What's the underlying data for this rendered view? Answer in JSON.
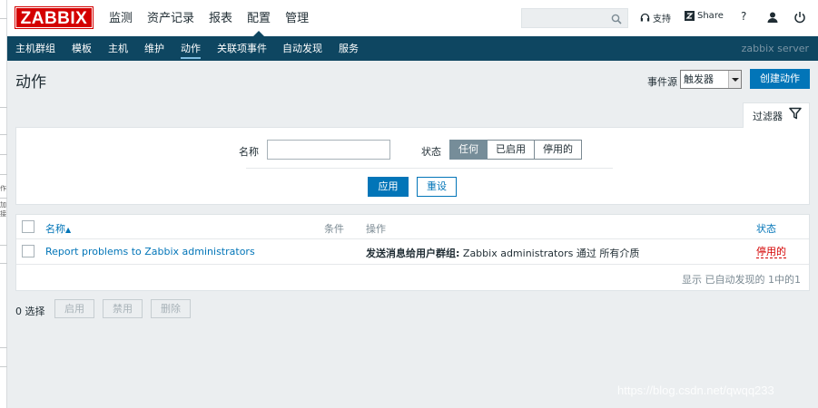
{
  "header": {
    "logo": "ZABBIX",
    "menu": [
      "监测",
      "资产记录",
      "报表",
      "配置",
      "管理"
    ],
    "selected_menu": "配置",
    "search": {
      "value": "",
      "placeholder": ""
    },
    "support_label": "支持",
    "share_label": "Share",
    "help_label": "?"
  },
  "subnav": {
    "items": [
      "主机群组",
      "模板",
      "主机",
      "维护",
      "动作",
      "关联项事件",
      "自动发现",
      "服务"
    ],
    "selected": "动作",
    "server_name": "zabbix server"
  },
  "page": {
    "title": "动作",
    "event_source_label": "事件源",
    "event_source_value": "触发器",
    "create_button": "创建动作"
  },
  "filter": {
    "tab_label": "过滤器",
    "name_label": "名称",
    "name_value": "",
    "status_label": "状态",
    "status_options": [
      "任何",
      "已启用",
      "停用的"
    ],
    "status_selected": "任何",
    "apply_button": "应用",
    "reset_button": "重设"
  },
  "table": {
    "columns": {
      "name": "名称",
      "sort_indicator": "▲",
      "conditions": "条件",
      "operations": "操作",
      "status": "状态"
    },
    "rows": [
      {
        "name": "Report problems to Zabbix administrators",
        "conditions": "",
        "operation_bold": "发送消息给用户群组:",
        "operation_rest": "Zabbix administrators 通过 所有介质",
        "status": "停用的"
      }
    ],
    "summary": "显示 已自动发现的 1中的1"
  },
  "footer": {
    "selected_count": "0 选择",
    "buttons": [
      "启用",
      "禁用",
      "删除"
    ]
  },
  "left_strip_text": [
    "作",
    "加",
    "接"
  ],
  "watermark": "https://blog.csdn.net/qwqq233",
  "colors": {
    "brand_red": "#d40000",
    "nav_blue": "#0e4661",
    "accent_blue": "#0275b8",
    "disabled_red": "#d40000"
  }
}
